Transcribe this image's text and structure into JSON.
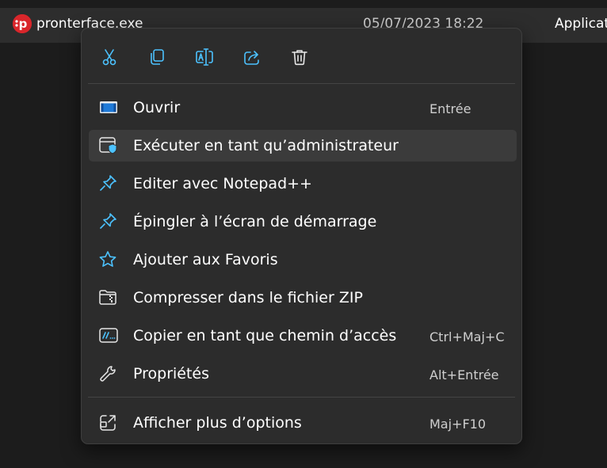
{
  "file_row": {
    "name": "pronterface.exe",
    "date": "05/07/2023 18:22",
    "type": "Applicat",
    "icon": "pronterface-app-icon"
  },
  "toolbar": {
    "icons": [
      "cut-icon",
      "copy-icon",
      "rename-icon",
      "share-icon",
      "delete-icon"
    ]
  },
  "menu": {
    "items": [
      {
        "label": "Ouvrir",
        "shortcut": "Entrée",
        "icon": "open-window-icon"
      },
      {
        "label": "Exécuter en tant qu’administrateur",
        "shortcut": "",
        "icon": "run-as-admin-shield-icon"
      },
      {
        "label": "Editer avec Notepad++",
        "shortcut": "",
        "icon": "pin-icon"
      },
      {
        "label": "Épingler à l’écran de démarrage",
        "shortcut": "",
        "icon": "pin-icon"
      },
      {
        "label": "Ajouter aux Favoris",
        "shortcut": "",
        "icon": "star-icon"
      },
      {
        "label": "Compresser dans le fichier ZIP",
        "shortcut": "",
        "icon": "zip-folder-icon"
      },
      {
        "label": "Copier en tant que chemin d’accès",
        "shortcut": "Ctrl+Maj+C",
        "icon": "copy-path-icon"
      },
      {
        "label": "Propriétés",
        "shortcut": "Alt+Entrée",
        "icon": "wrench-icon"
      }
    ],
    "more": {
      "label": "Afficher plus d’options",
      "shortcut": "Maj+F10",
      "icon": "more-options-icon"
    }
  },
  "colors": {
    "accent": "#4cc2ff",
    "menu_bg": "#2c2c2c",
    "hover_bg": "#3b3b3b",
    "app_icon_red": "#d9262b"
  }
}
